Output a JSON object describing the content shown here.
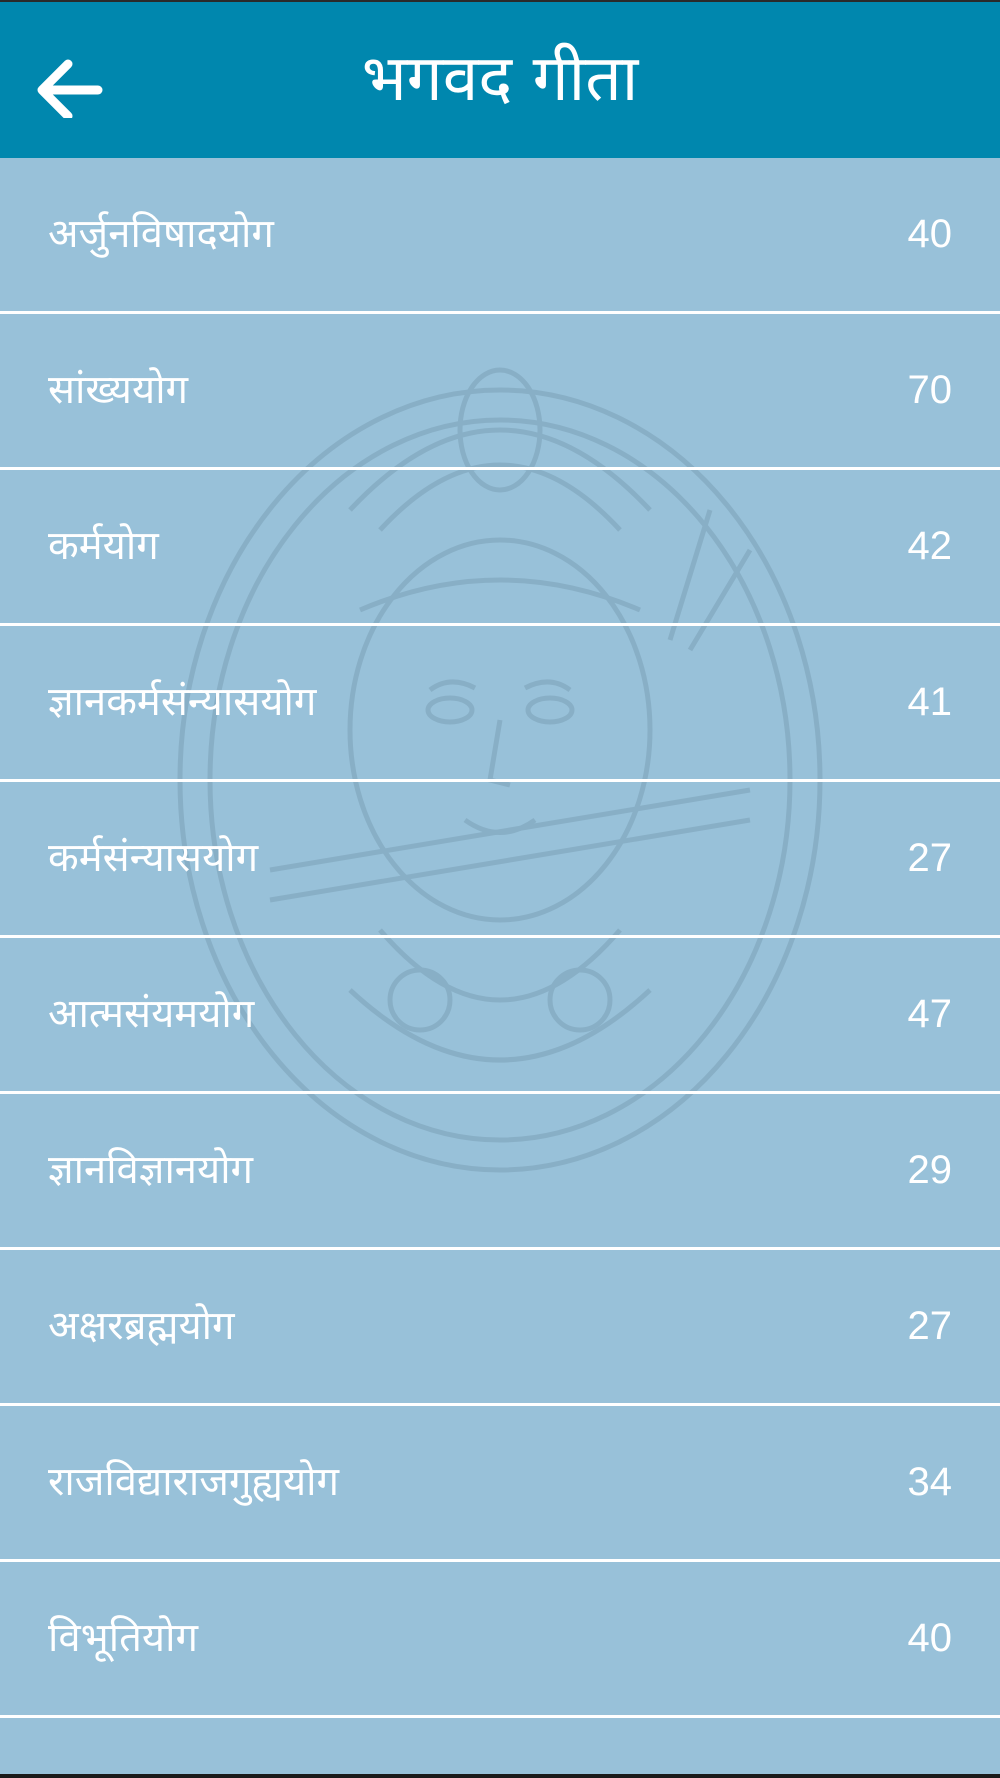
{
  "header": {
    "title": "भगवद गीता",
    "back_icon": "arrow-left-icon",
    "background_color": "#0087ae"
  },
  "list_background_color": "#98c1d9",
  "chapters": [
    {
      "name": "अर्जुनविषादयोग",
      "count": "40"
    },
    {
      "name": "सांख्ययोग",
      "count": "70"
    },
    {
      "name": "कर्मयोग",
      "count": "42"
    },
    {
      "name": "ज्ञानकर्मसंन्यासयोग",
      "count": "41"
    },
    {
      "name": "कर्मसंन्यासयोग",
      "count": "27"
    },
    {
      "name": "आत्मसंयमयोग",
      "count": "47"
    },
    {
      "name": "ज्ञानविज्ञानयोग",
      "count": "29"
    },
    {
      "name": "अक्षरब्रह्मयोग",
      "count": "27"
    },
    {
      "name": "राजविद्याराजगुह्ययोग",
      "count": "34"
    },
    {
      "name": "विभूतियोग",
      "count": "40"
    }
  ]
}
